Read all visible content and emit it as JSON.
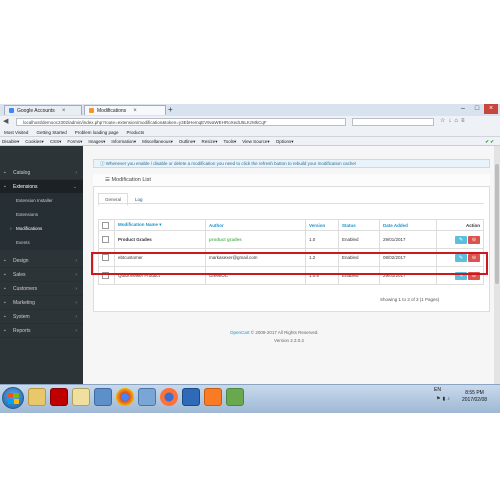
{
  "browser": {
    "tabs": [
      "Google Accounts",
      "Modifications"
    ],
    "url": "localhost/demooc2302/admin/index.php?route=extension/modification&token=y3EbHemqEV9vaWEHRoXedU5LKzMkCqF",
    "search_placeholder": "",
    "bookmarks": [
      "Most Visited",
      "Getting Started",
      "Problem loading page",
      "Products"
    ],
    "devtools": [
      "Disable▾",
      "Cookies▾",
      "CSS▾",
      "Forms▾",
      "Images▾",
      "Information▾",
      "Miscellaneous▾",
      "Outline▾",
      "Resize▾",
      "Tools▾",
      "View Source▾",
      "Options▾"
    ]
  },
  "sidebar": {
    "items": [
      {
        "label": "Catalog"
      },
      {
        "label": "Extensions"
      },
      {
        "label": "Extension Installer"
      },
      {
        "label": "Extensions"
      },
      {
        "label": "Modifications"
      },
      {
        "label": "Events"
      },
      {
        "label": "Design"
      },
      {
        "label": "Sales"
      },
      {
        "label": "Customers"
      },
      {
        "label": "Marketing"
      },
      {
        "label": "System"
      },
      {
        "label": "Reports"
      }
    ]
  },
  "alert": "Whenever you enable / disable or delete a modification you need to click the refresh button to rebuild your modification cache!",
  "panel": {
    "title": "Modification List",
    "tabs": [
      "General",
      "Log"
    ]
  },
  "table": {
    "headers": [
      "Modification Name",
      "Author",
      "Version",
      "Status",
      "Date Added",
      "Action"
    ],
    "rows": [
      {
        "name": "Product Grades",
        "author": "product grades",
        "version": "1.0",
        "status": "Enabled",
        "date": "29/01/2017"
      },
      {
        "name": "ebtcustomer",
        "author": "markasexer@gmail.com",
        "version": "1.2",
        "status": "Enabled",
        "date": "08/02/2017"
      },
      {
        "name": "QuickViewer Product",
        "author": "GreekOC",
        "version": "1.0.6",
        "status": "Enabled",
        "date": "29/01/2017"
      }
    ],
    "pagination": "Showing 1 to 3 of 3 (1 Pages)"
  },
  "footer": {
    "brand": "OpenCart",
    "copyright": "© 2009-2017 All Rights Reserved.",
    "version": "Version 2.3.0.2"
  },
  "taskbar": {
    "lang": "EN",
    "time": "8:55 PM",
    "date": "2017/02/08"
  }
}
